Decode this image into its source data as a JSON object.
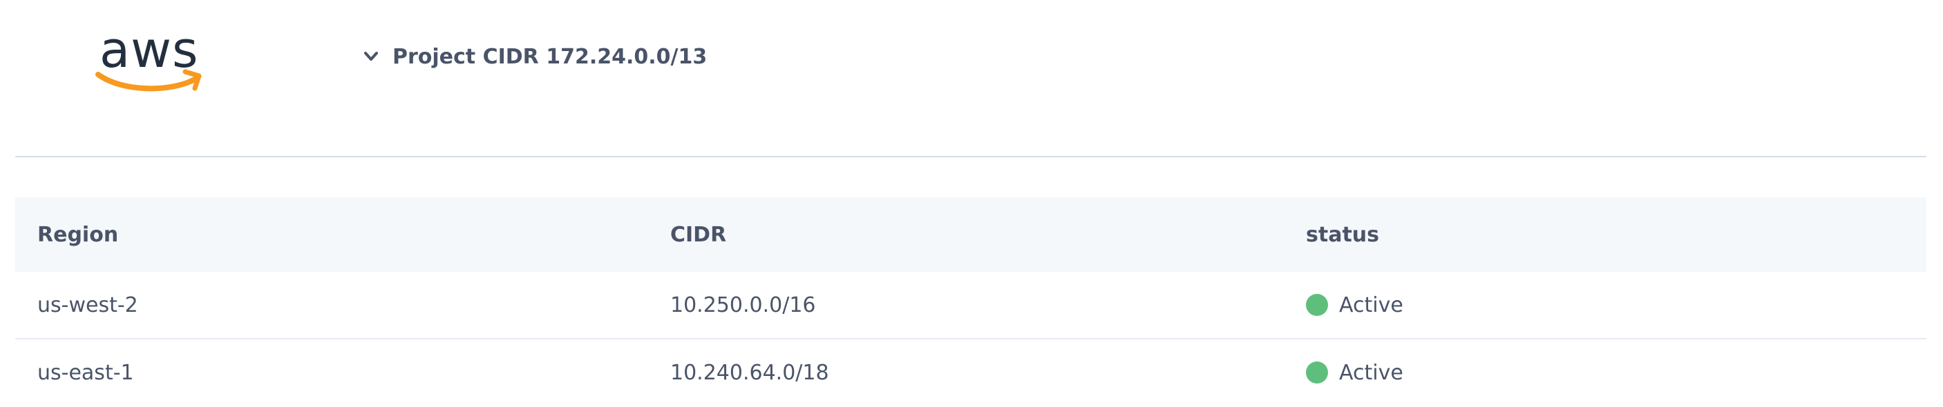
{
  "logo": {
    "text": "aws",
    "icon": "aws-logo",
    "text_color": "#232f3e",
    "smile_color": "#f79a1f"
  },
  "project": {
    "toggle_icon": "chevron-down-icon",
    "label": "Project CIDR 172.24.0.0/13"
  },
  "table": {
    "headers": {
      "region": "Region",
      "cidr": "CIDR",
      "status": "status"
    },
    "rows": [
      {
        "region": "us-west-2",
        "cidr": "10.250.0.0/16",
        "status": "Active",
        "status_color": "#5ebf7d"
      },
      {
        "region": "us-east-1",
        "cidr": "10.240.64.0/18",
        "status": "Active",
        "status_color": "#5ebf7d"
      }
    ]
  },
  "colors": {
    "header_bg": "#f5f8fb",
    "divider": "#d5dde9",
    "text": "#4a5468"
  }
}
